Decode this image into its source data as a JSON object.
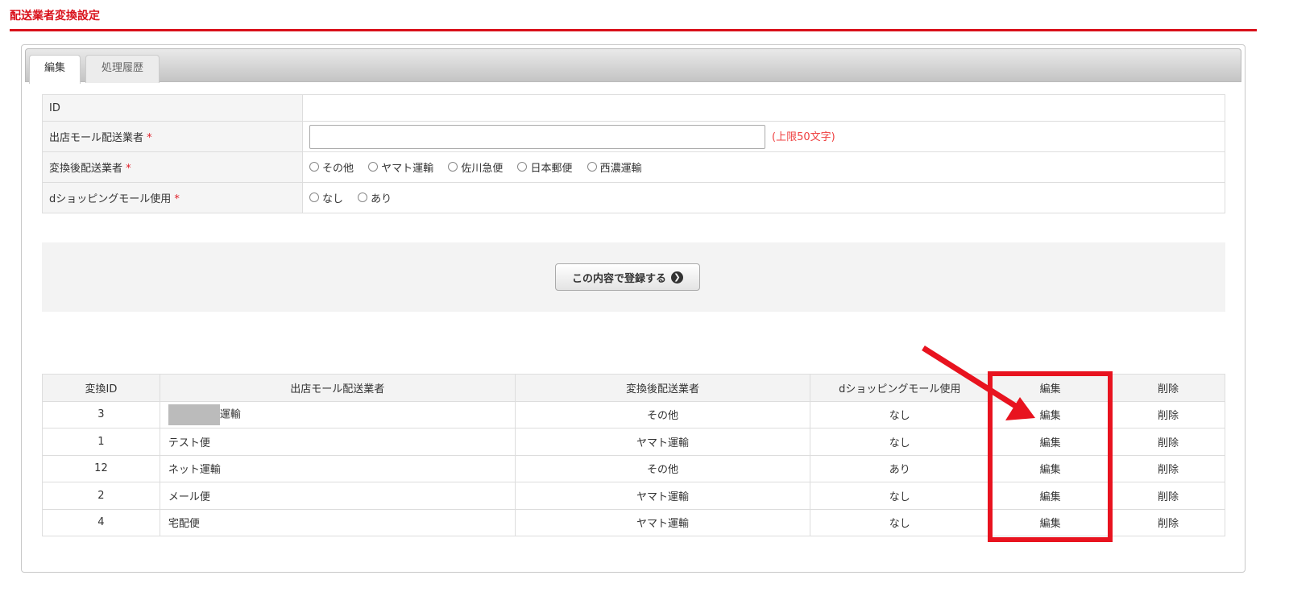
{
  "page_title": "配送業者変換設定",
  "tabs": [
    {
      "label": "編集"
    },
    {
      "label": "処理履歴"
    }
  ],
  "form": {
    "id_label": "ID",
    "id_value": "",
    "mall_label": "出店モール配送業者",
    "mall_value": "",
    "mall_limit": "(上限50文字)",
    "conv_label": "変換後配送業者",
    "conv_options": [
      "その他",
      "ヤマト運輸",
      "佐川急便",
      "日本郵便",
      "西濃運輸"
    ],
    "dshop_label": "dショッピングモール使用",
    "dshop_options": [
      "なし",
      "あり"
    ],
    "required_mark": "*"
  },
  "submit_label": "この内容で登録する",
  "list": {
    "headers": [
      "変換ID",
      "出店モール配送業者",
      "変換後配送業者",
      "dショッピングモール使用",
      "編集",
      "削除"
    ],
    "rows": [
      {
        "id": "3",
        "mall": "運輸",
        "conv": "その他",
        "dshop": "なし",
        "edit": "編集",
        "del": "削除"
      },
      {
        "id": "1",
        "mall": "テスト便",
        "conv": "ヤマト運輸",
        "dshop": "なし",
        "edit": "編集",
        "del": "削除"
      },
      {
        "id": "12",
        "mall": "ネット運輸",
        "conv": "その他",
        "dshop": "あり",
        "edit": "編集",
        "del": "削除"
      },
      {
        "id": "2",
        "mall": "メール便",
        "conv": "ヤマト運輸",
        "dshop": "なし",
        "edit": "編集",
        "del": "削除"
      },
      {
        "id": "4",
        "mall": "宅配便",
        "conv": "ヤマト運輸",
        "dshop": "なし",
        "edit": "編集",
        "del": "削除"
      }
    ]
  },
  "colors": {
    "accent": "#d9101a",
    "annotation": "#e8131f"
  }
}
